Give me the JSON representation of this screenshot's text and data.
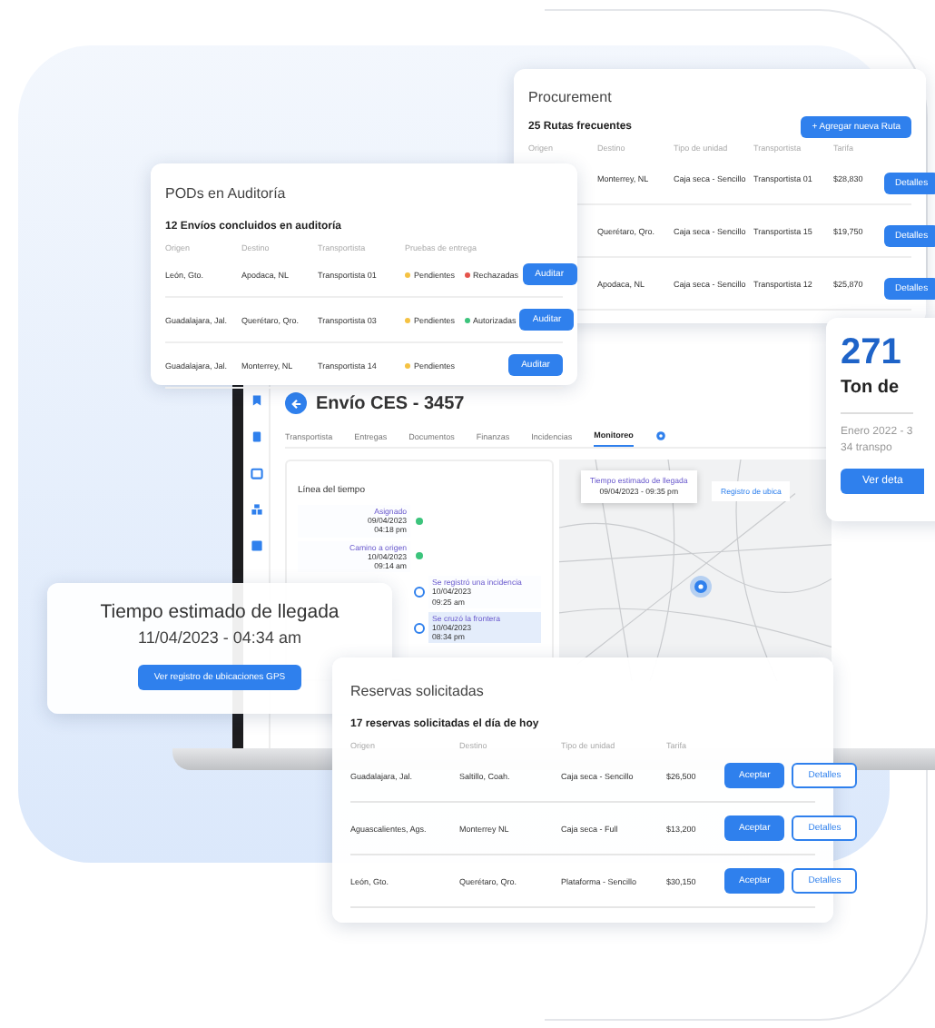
{
  "procurement": {
    "title": "Procurement",
    "subtitle": "25 Rutas frecuentes",
    "add_button": "+ Agregar nueva Ruta",
    "columns": [
      "Origen",
      "Destino",
      "Tipo de unidad",
      "Transportista",
      "Tarifa"
    ],
    "rows": [
      {
        "destination": "Monterrey, NL",
        "unit": "Caja seca - Sencillo",
        "carrier": "Transportista 01",
        "rate": "$28,830",
        "button": "Detalles"
      },
      {
        "destination": "Querétaro, Qro.",
        "unit": "Caja seca - Sencillo",
        "carrier": "Transportista 15",
        "rate": "$19,750",
        "button": "Detalles"
      },
      {
        "destination": "Apodaca, NL",
        "unit": "Caja seca - Sencillo",
        "carrier": "Transportista 12",
        "rate": "$25,870",
        "button": "Detalles"
      }
    ]
  },
  "pods": {
    "title": "PODs en Auditoría",
    "subtitle": "12 Envíos concluidos en auditoría",
    "columns": [
      "Origen",
      "Destino",
      "Transportista",
      "Pruebas de entrega"
    ],
    "rows": [
      {
        "origin": "León, Gto.",
        "destination": "Apodaca, NL",
        "carrier": "Transportista 01",
        "proofs": [
          {
            "label": "Pendientes",
            "color": "#f5c242"
          },
          {
            "label": "Rechazadas",
            "color": "#e5534b"
          }
        ],
        "button": "Auditar"
      },
      {
        "origin": "Guadalajara, Jal.",
        "destination": "Querétaro, Qro.",
        "carrier": "Transportista 03",
        "proofs": [
          {
            "label": "Pendientes",
            "color": "#f5c242"
          },
          {
            "label": "Autorizadas",
            "color": "#3cc47c"
          }
        ],
        "button": "Auditar"
      },
      {
        "origin": "Guadalajara, Jal.",
        "destination": "Monterrey, NL",
        "carrier": "Transportista 14",
        "proofs": [
          {
            "label": "Pendientes",
            "color": "#f5c242"
          }
        ],
        "button": "Auditar"
      }
    ]
  },
  "laptop": {
    "title": "Envío CES - 3457",
    "tabs": [
      {
        "label": "Transportista",
        "selected": false
      },
      {
        "label": "Entregas",
        "selected": false
      },
      {
        "label": "Documentos",
        "selected": false
      },
      {
        "label": "Finanzas",
        "selected": false
      },
      {
        "label": "Incidencias",
        "selected": false
      },
      {
        "label": "Monitoreo",
        "selected": true
      }
    ],
    "timeline": {
      "title": "Línea del tiempo",
      "events": [
        {
          "kind": "milestone",
          "label": "Asignado",
          "date": "09/04/2023",
          "time": "04:18 pm",
          "highlighted": false
        },
        {
          "kind": "milestone",
          "label": "Camino a origen",
          "date": "10/04/2023",
          "time": "09:14 am",
          "highlighted": false
        },
        {
          "kind": "event",
          "label": "Se registró una incidencia",
          "date": "10/04/2023",
          "time": "09:25 am",
          "highlighted": false
        },
        {
          "kind": "event",
          "label": "Se cruzó la frontera",
          "date": "10/04/2023",
          "time": "08:34 pm",
          "highlighted": true
        }
      ]
    },
    "map": {
      "eta_label": "Tiempo estimado de llegada",
      "eta_value": "09/04/2023 - 09:35 pm",
      "gps_link": "Registro de ubica"
    }
  },
  "kpi": {
    "value": "271",
    "label": "Ton de",
    "period": "Enero 2022 - 3",
    "carriers": "34 transpo",
    "button": "Ver deta"
  },
  "eta_card": {
    "title": "Tiempo estimado de llegada",
    "value": "11/04/2023 - 04:34 am",
    "button": "Ver registro de ubicaciones GPS"
  },
  "reservas": {
    "title": "Reservas solicitadas",
    "subtitle": "17 reservas solicitadas el día de hoy",
    "columns": [
      "Origen",
      "Destino",
      "Tipo de unidad",
      "Tarifa"
    ],
    "rows": [
      {
        "origin": "Guadalajara, Jal.",
        "destination": "Saltillo, Coah.",
        "unit": "Caja seca - Sencillo",
        "rate": "$26,500",
        "accept": "Aceptar",
        "details": "Detalles"
      },
      {
        "origin": "Aguascalientes, Ags.",
        "destination": "Monterrey NL",
        "unit": "Caja seca - Full",
        "rate": "$13,200",
        "accept": "Aceptar",
        "details": "Detalles"
      },
      {
        "origin": "León, Gto.",
        "destination": "Querétaro, Qro.",
        "unit": "Plataforma - Sencillo",
        "rate": "$30,150",
        "accept": "Aceptar",
        "details": "Detalles"
      }
    ]
  }
}
